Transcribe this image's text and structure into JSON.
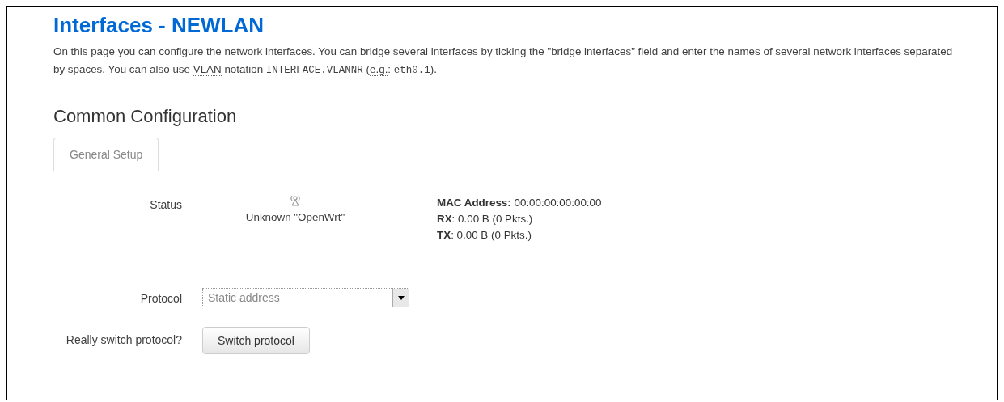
{
  "title": "Interfaces - NEWLAN",
  "description": [
    {
      "kind": "text",
      "text": "On this page you can configure the network interfaces. You can bridge several interfaces by ticking the \"bridge interfaces\" field and enter the names of several network interfaces separated by spaces. You can also use "
    },
    {
      "kind": "abbr",
      "text": "VLAN"
    },
    {
      "kind": "text",
      "text": " notation "
    },
    {
      "kind": "code",
      "text": "INTERFACE.VLANNR"
    },
    {
      "kind": "text",
      "text": " ("
    },
    {
      "kind": "abbr",
      "text": "e.g."
    },
    {
      "kind": "text",
      "text": ": "
    },
    {
      "kind": "code",
      "text": "eth0.1"
    },
    {
      "kind": "text",
      "text": ")."
    }
  ],
  "section_title": "Common Configuration",
  "tabs": [
    {
      "label": "General Setup",
      "selected": true
    }
  ],
  "status": {
    "label": "Status",
    "device": "Unknown \"OpenWrt\"",
    "stats": [
      "**MAC Address:** 00:00:00:00:00:00",
      "**RX**: 0.00 B (0 Pkts.)",
      "**TX**: 0.00 B (0 Pkts.)"
    ]
  },
  "protocol": {
    "label": "Protocol",
    "value": "Static address"
  },
  "switch": {
    "label": "Really switch protocol?",
    "button": "Switch protocol"
  }
}
